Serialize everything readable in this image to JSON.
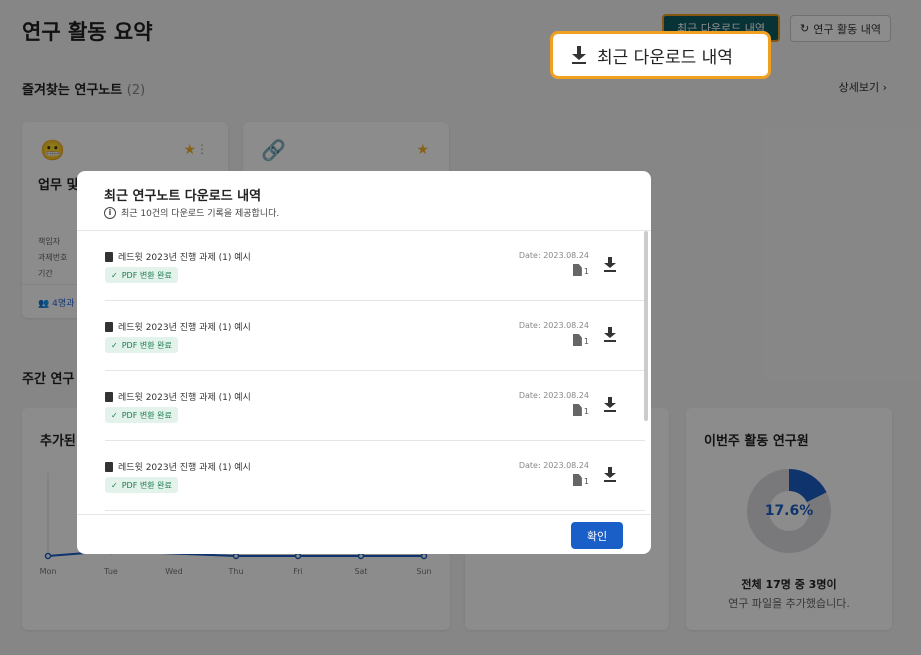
{
  "page": {
    "title": "연구 활동 요약",
    "download_history_btn": "최근 다운로드 내역",
    "activity_history_btn": "연구 활동 내역",
    "favorites_title": "즐겨찾는 연구노트",
    "favorites_count": "(2)",
    "detail_link": "상세보기",
    "weekly_title": "주간 연구",
    "added_title": "추가된",
    "researchers_title": "이번주 활동 연구원"
  },
  "note_cards": [
    {
      "name": "업무 및",
      "meta_labels": [
        "책임자",
        "과제번호",
        "기간"
      ],
      "members": "4명과"
    },
    {
      "name": "",
      "meta_labels": [],
      "members": ""
    }
  ],
  "chart_data": {
    "type": "line",
    "categories": [
      "Mon",
      "Tue",
      "Wed",
      "Thu",
      "Fri",
      "Sat",
      "Sun"
    ],
    "series": [
      {
        "values": [
          0,
          1,
          null,
          0,
          0,
          0,
          0
        ]
      }
    ]
  },
  "donut": {
    "percent_label": "17.6%",
    "fraction": 0.176,
    "summary": "전체 17명 중 3명이",
    "sub": "연구 파일을 추가했습니다."
  },
  "callout": {
    "label": "최근 다운로드 내역"
  },
  "modal": {
    "title": "최근 연구노트 다운로드 내역",
    "info": "최근 10건의 다운로드 기록을 제공합니다.",
    "confirm": "확인",
    "items": [
      {
        "name": "레드윗 2023년 진행 과제 (1) 예시",
        "status": "PDF 변환 완료",
        "date": "Date: 2023.08.24",
        "pages": "1"
      },
      {
        "name": "레드윗 2023년 진행 과제 (1) 예시",
        "status": "PDF 변환 완료",
        "date": "Date: 2023.08.24",
        "pages": "1"
      },
      {
        "name": "레드윗 2023년 진행 과제 (1) 예시",
        "status": "PDF 변환 완료",
        "date": "Date: 2023.08.24",
        "pages": "1"
      },
      {
        "name": "레드윗 2023년 진행 과제 (1) 예시",
        "status": "PDF 변환 완료",
        "date": "Date: 2023.08.24",
        "pages": "1"
      }
    ]
  },
  "colors": {
    "primary": "#1a5ec7",
    "accent": "#f0a020",
    "teal": "#0d5c63",
    "badge_bg": "#e3f3ec",
    "star": "#f2b32d"
  }
}
